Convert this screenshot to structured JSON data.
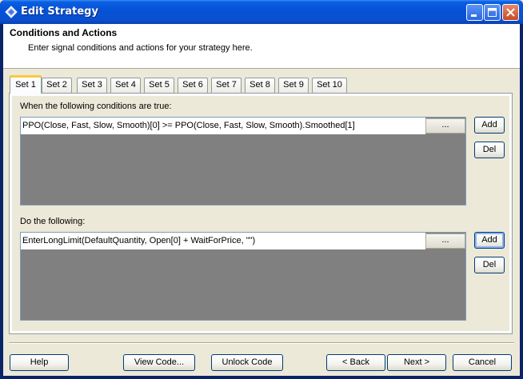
{
  "window": {
    "title": "Edit Strategy"
  },
  "header": {
    "title": "Conditions and Actions",
    "subtitle": "Enter signal conditions and actions for your strategy here."
  },
  "tabs": [
    {
      "label": "Set 1"
    },
    {
      "label": "Set 2"
    },
    {
      "label": "Set 3"
    },
    {
      "label": "Set 4"
    },
    {
      "label": "Set 5"
    },
    {
      "label": "Set 6"
    },
    {
      "label": "Set 7"
    },
    {
      "label": "Set 8"
    },
    {
      "label": "Set 9"
    },
    {
      "label": "Set 10"
    }
  ],
  "conditions": {
    "label": "When the following conditions are true:",
    "rows": [
      "PPO(Close,  Fast,  Slow,  Smooth)[0]  >=  PPO(Close,  Fast,  Slow,  Smooth).Smoothed[1]"
    ],
    "ellipsis_label": "...",
    "add_label": "Add",
    "del_label": "Del"
  },
  "actions": {
    "label": "Do the following:",
    "rows": [
      "EnterLongLimit(DefaultQuantity,  Open[0]  +  WaitForPrice,  \"\")"
    ],
    "ellipsis_label": "...",
    "add_label": "Add",
    "del_label": "Del"
  },
  "footer": {
    "help_label": "Help",
    "view_code_label": "View Code...",
    "unlock_code_label": "Unlock Code",
    "back_label": "< Back",
    "next_label": "Next >",
    "cancel_label": "Cancel"
  },
  "colors": {
    "titlebar": "#0553D6",
    "active_tab_accent": "#FFC83C",
    "list_background": "#808080"
  }
}
